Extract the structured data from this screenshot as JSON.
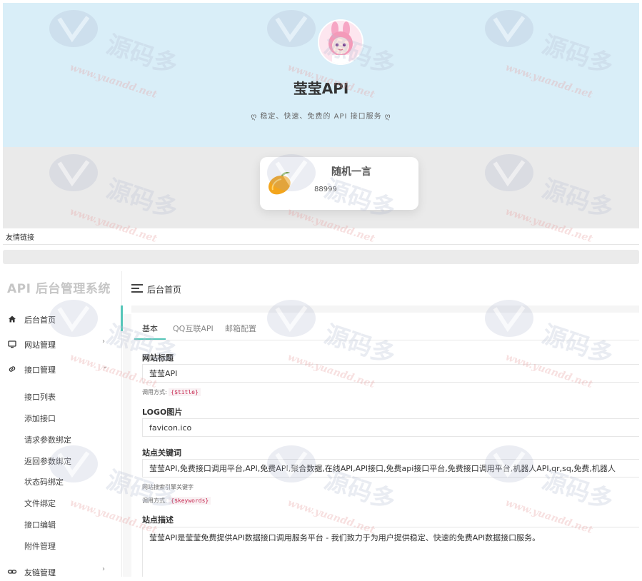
{
  "hero": {
    "title": "莹莹API",
    "slogan": "稳定、快速、免费的 API 接口服务"
  },
  "quote": {
    "title": "随机一言",
    "text": "88999"
  },
  "friend_links": {
    "label": "友情链接"
  },
  "admin": {
    "brand": "API 后台管理系统",
    "page_title": "后台首页",
    "menu": [
      {
        "label": "后台首页",
        "icon": "home-icon"
      },
      {
        "label": "网站管理",
        "icon": "monitor-icon",
        "arrow": "›"
      },
      {
        "label": "接口管理",
        "icon": "link-icon",
        "arrow": "⌄"
      }
    ],
    "submenu": [
      "接口列表",
      "添加接口",
      "请求参数绑定",
      "返回参数绑定",
      "状态码绑定",
      "文件绑定",
      "接口编辑",
      "附件管理"
    ],
    "menu_bottom": {
      "label": "友链管理",
      "icon": "link-icon",
      "arrow": "›"
    }
  },
  "tabs": [
    "基本",
    "QQ互联API",
    "邮箱配置"
  ],
  "form": {
    "site_title": {
      "label": "网站标题",
      "value": "莹莹API",
      "hint_prefix": "调用方式:",
      "hint_code": "{$title}"
    },
    "logo": {
      "label": "LOGO图片",
      "value": "favicon.ico"
    },
    "keywords": {
      "label": "站点关键词",
      "value": "莹莹API,免费接口调用平台,API,免费API,聚合数据,在线API,API接口,免费api接口平台,免费接口调用平台,机器人API,qr,sq,免费,机器人",
      "hint": "网站搜索引擎关键字",
      "hint_prefix": "调用方式:",
      "hint_code": "{$keywords}"
    },
    "description": {
      "label": "站点描述",
      "value": "莹莹API是莹莹免费提供API数据接口调用服务平台 - 我们致力于为用户提供稳定、快速的免费API数据接口服务。"
    }
  },
  "watermark": {
    "text": "源码多",
    "url": "www.yuandd.net"
  },
  "colors": {
    "accent": "#56c6b9",
    "hero_bg": "#d9eef8",
    "code": "#c7254e"
  }
}
